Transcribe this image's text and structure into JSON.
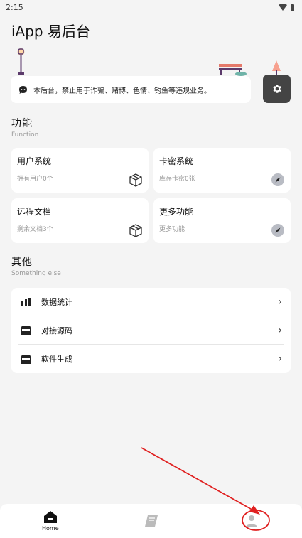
{
  "status_bar": {
    "time": "2:15"
  },
  "app": {
    "title": "iApp 易后台"
  },
  "notice": {
    "text": "本后台，禁止用于诈骗、赌博、色情、钓鱼等违规业务。",
    "icon": "chat-bubble-icon"
  },
  "settings": {
    "icon": "gear-icon"
  },
  "functions_section": {
    "title": "功能",
    "subtitle": "Function"
  },
  "functions": [
    {
      "title": "用户系统",
      "subtitle": "拥有用户0个",
      "icon": "box-icon"
    },
    {
      "title": "卡密系统",
      "subtitle": "库存卡密0张",
      "icon": "compass-icon"
    },
    {
      "title": "远程文档",
      "subtitle": "剩余文档3个",
      "icon": "box-icon"
    },
    {
      "title": "更多功能",
      "subtitle": "更多功能",
      "icon": "compass-icon"
    }
  ],
  "other_section": {
    "title": "其他",
    "subtitle": "Something else"
  },
  "other_items": [
    {
      "label": "数据统计",
      "icon": "bar-chart-icon"
    },
    {
      "label": "对接源码",
      "icon": "inbox-icon"
    },
    {
      "label": "软件生成",
      "icon": "inbox-icon"
    }
  ],
  "bottom_nav": [
    {
      "label": "Home",
      "icon": "home-icon"
    },
    {
      "label": "",
      "icon": "book-icon"
    },
    {
      "label": "",
      "icon": "person-icon"
    }
  ],
  "colors": {
    "background": "#f4f4f4",
    "card": "#ffffff",
    "settings_button": "#444444",
    "annotation": "#e02020"
  }
}
